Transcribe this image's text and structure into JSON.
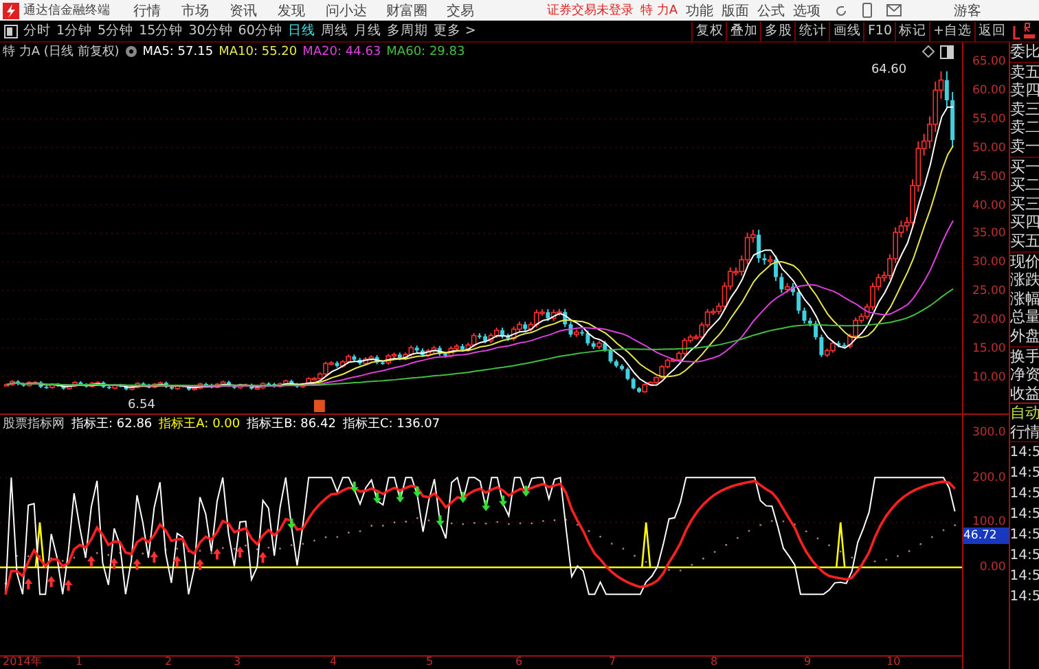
{
  "app": {
    "title": "通达信金融终端",
    "menu": [
      "行情",
      "市场",
      "资讯",
      "发现",
      "问小达",
      "财富圈",
      "交易"
    ],
    "login_status": "证券交易未登录",
    "stock": "特 力A",
    "tools": [
      "功能",
      "版面",
      "公式",
      "选项"
    ],
    "user": "游客"
  },
  "toolbar": {
    "periods": [
      {
        "label": "分时",
        "selected": false
      },
      {
        "label": "1分钟",
        "selected": false
      },
      {
        "label": "5分钟",
        "selected": false
      },
      {
        "label": "15分钟",
        "selected": false
      },
      {
        "label": "30分钟",
        "selected": false
      },
      {
        "label": "60分钟",
        "selected": false
      },
      {
        "label": "日线",
        "selected": true
      },
      {
        "label": "周线",
        "selected": false
      },
      {
        "label": "月线",
        "selected": false
      },
      {
        "label": "多周期",
        "selected": false
      }
    ],
    "more": "更多 >",
    "actions": [
      "复权",
      "叠加",
      "多股",
      "统计",
      "画线",
      "F10",
      "标记",
      "+自选",
      "返回"
    ]
  },
  "price_chart": {
    "title": "特 力A (日线 前复权)",
    "mas": [
      {
        "label": "MA5: 57.15",
        "color": "#ffffff"
      },
      {
        "label": "MA10: 55.20",
        "color": "#e8e84a"
      },
      {
        "label": "MA20: 44.63",
        "color": "#e040e0"
      },
      {
        "label": "MA60: 29.83",
        "color": "#40c040"
      }
    ],
    "axis_labels": [
      "65.00",
      "60.00",
      "55.00",
      "50.00",
      "45.00",
      "40.00",
      "35.00",
      "30.00",
      "25.00",
      "20.00",
      "15.00",
      "10.00"
    ],
    "high_label": "64.60",
    "low_label": "6.54"
  },
  "indicator": {
    "name": "股票指标网",
    "values": [
      {
        "label": "指标王: 62.86",
        "color": "#ffffff"
      },
      {
        "label": "指标王A: 0.00",
        "color": "#ffff00"
      },
      {
        "label": "指标王B: 86.42",
        "color": "#ffffff"
      },
      {
        "label": "指标王C: 136.07",
        "color": "#ffffff"
      }
    ],
    "axis_labels": [
      "300.0",
      "200.0",
      "100.0",
      "0.00"
    ],
    "current": "46.72"
  },
  "x_axis": [
    "2014年",
    "1",
    "2",
    "3",
    "4",
    "5",
    "6",
    "7",
    "8",
    "9",
    "10"
  ],
  "quote_panel": {
    "groups": [
      [
        "委比"
      ],
      [
        "卖五",
        "卖四",
        "卖三",
        "卖二",
        "卖一"
      ],
      [
        "买一",
        "买二",
        "买三",
        "买四",
        "买五"
      ],
      [
        "现价",
        "涨跌",
        "涨幅",
        "总量",
        "外盘"
      ],
      [
        "换手",
        "净资",
        "收益"
      ]
    ],
    "mode": [
      "自动",
      "行情"
    ],
    "times": [
      "14:5",
      "14:5",
      "14:5",
      "14:5",
      "14:5",
      "14:5",
      "14:5",
      "14:5"
    ]
  }
}
